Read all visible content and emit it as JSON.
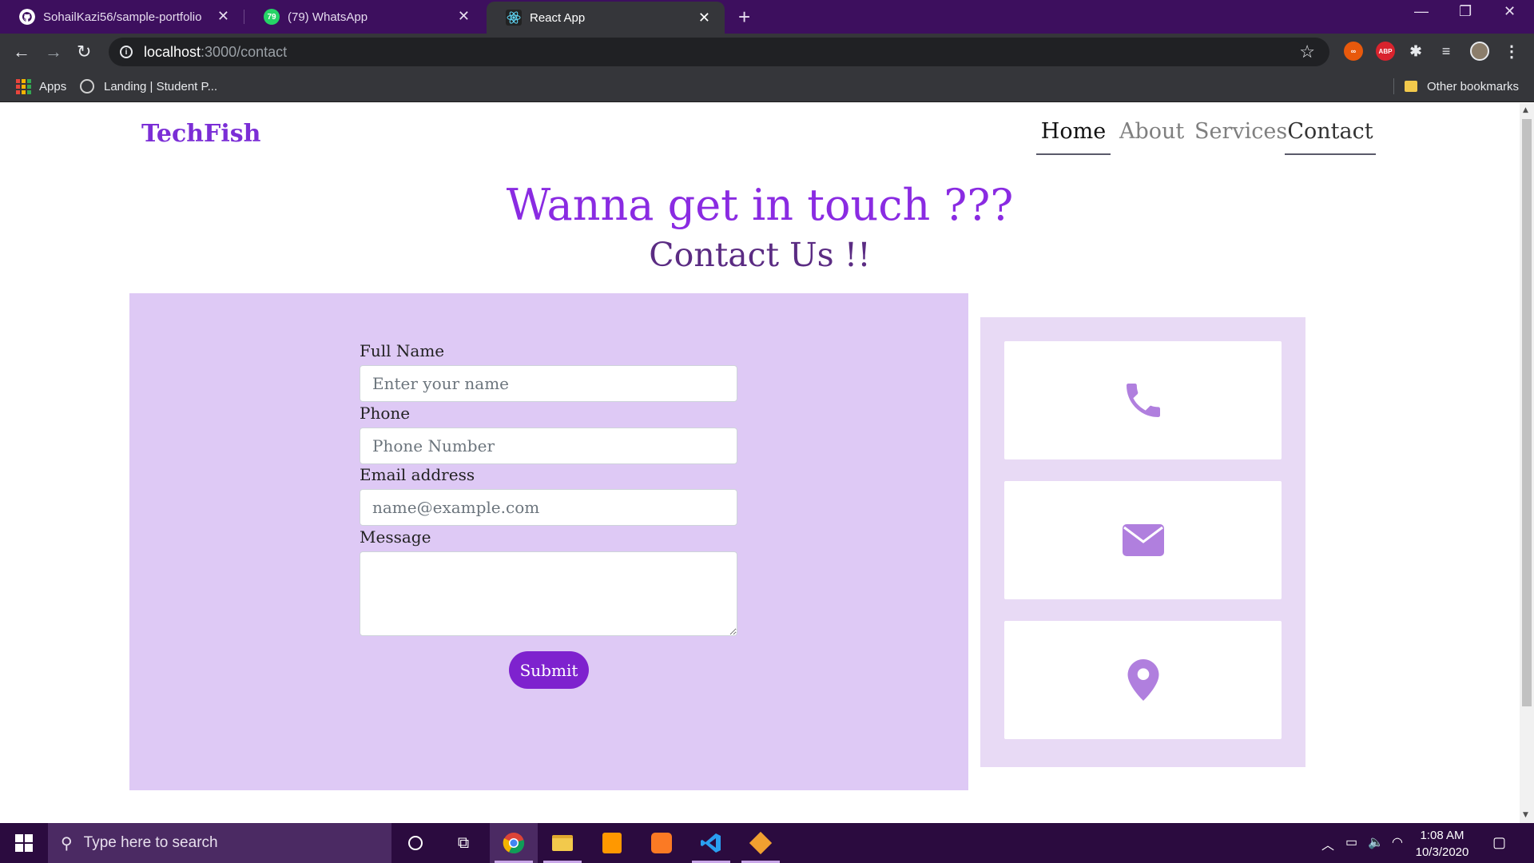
{
  "browser": {
    "tabs": [
      {
        "title": "SohailKazi56/sample-portfolio",
        "icon": "github-icon"
      },
      {
        "title": "(79) WhatsApp",
        "icon": "whatsapp-icon",
        "badge": "79"
      },
      {
        "title": "React App",
        "icon": "react-icon"
      }
    ],
    "url_host": "localhost",
    "url_path": ":3000/contact",
    "bookmarks": {
      "apps": "Apps",
      "landing": "Landing | Student P...",
      "other": "Other bookmarks"
    },
    "extensions": {
      "abp": "ABP"
    }
  },
  "site": {
    "brand": "TechFish",
    "nav": [
      "Home",
      "About",
      "Services",
      "Contact"
    ],
    "headline": "Wanna get in touch ???",
    "subhead": "Contact Us !!"
  },
  "form": {
    "name_label": "Full Name",
    "name_placeholder": "Enter your name",
    "phone_label": "Phone",
    "phone_placeholder": "Phone Number",
    "email_label": "Email address",
    "email_placeholder": "name@example.com",
    "message_label": "Message",
    "submit": "Submit"
  },
  "contact_cards": [
    {
      "icon": "phone-icon"
    },
    {
      "icon": "envelope-icon"
    },
    {
      "icon": "map-pin-icon"
    }
  ],
  "taskbar": {
    "search_placeholder": "Type here to search",
    "time": "1:08 AM",
    "date": "10/3/2020"
  },
  "colors": {
    "brand": "#7b2ed6",
    "form_bg": "#dec9f5",
    "info_bg": "#e8daf5",
    "icon": "#b07fde",
    "button": "#7e22ce"
  }
}
